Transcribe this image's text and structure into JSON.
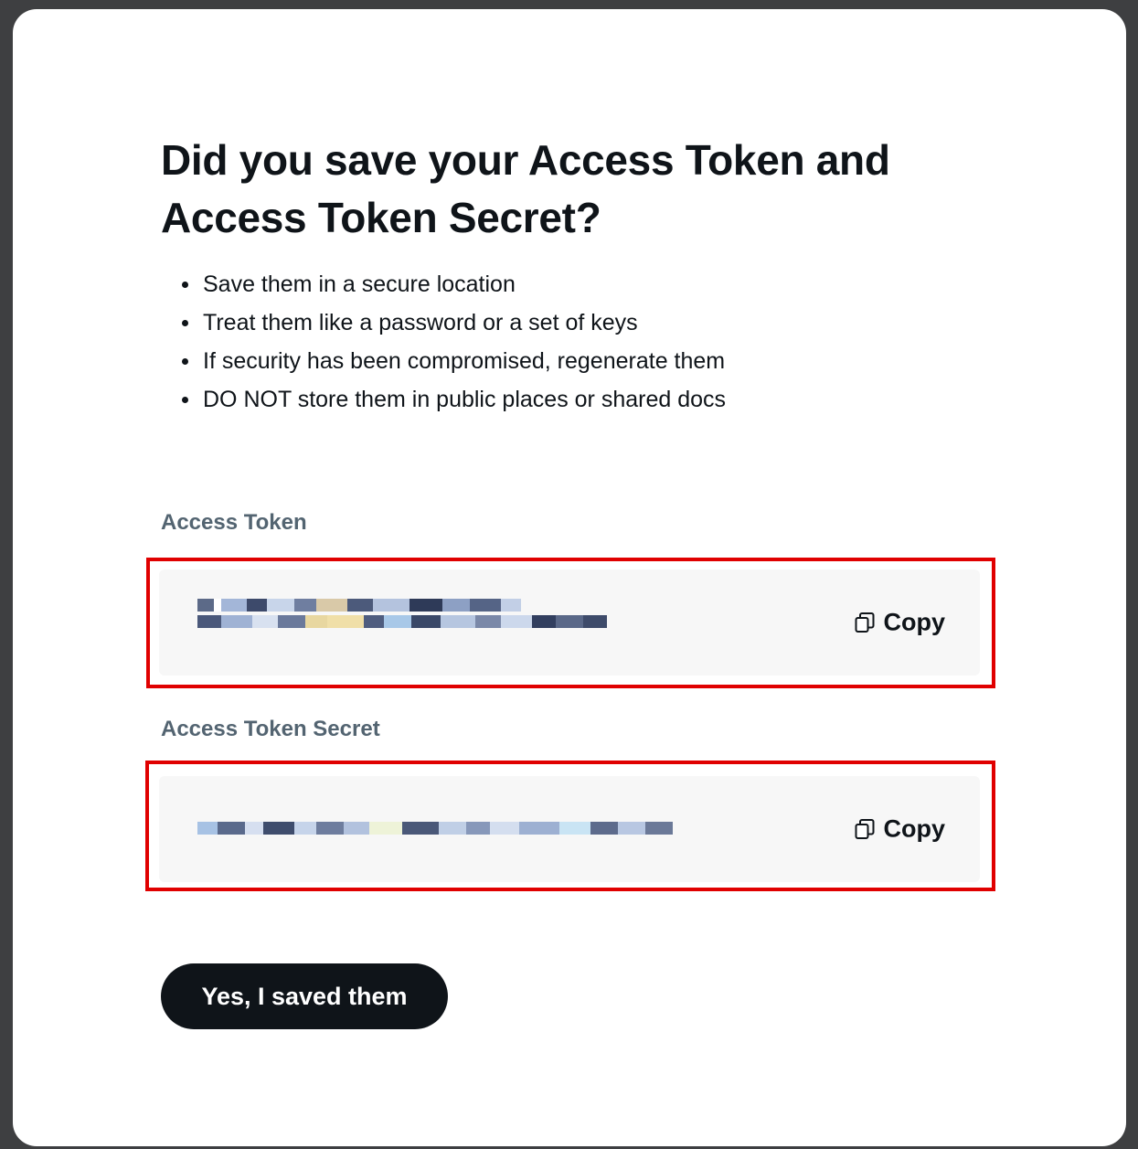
{
  "dialog": {
    "title": "Did you save your Access Token and Access Token Secret?",
    "tips": [
      "Save them in a secure location",
      "Treat them like a password or a set of keys",
      "If security has been compromised, regenerate them",
      "DO NOT store them in public places or shared docs"
    ],
    "access_token": {
      "label": "Access Token",
      "copy_label": "Copy",
      "value_redacted": true
    },
    "access_token_secret": {
      "label": "Access Token Secret",
      "copy_label": "Copy",
      "value_redacted": true
    },
    "confirm_label": "Yes, I saved them"
  },
  "colors": {
    "text_primary": "#0f1419",
    "text_secondary": "#536471",
    "highlight_border": "#e00000",
    "button_bg": "#0f1419",
    "field_bg": "#f7f7f7"
  },
  "icons": {
    "copy": "copy-icon"
  }
}
